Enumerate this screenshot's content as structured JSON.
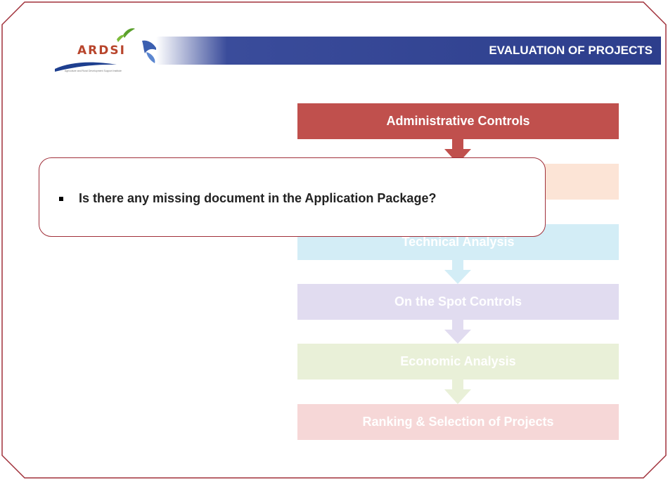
{
  "logo": {
    "name": "ARDSI",
    "tagline": "Agriculture and Rural Development Support Institute"
  },
  "header": {
    "title": "EVALUATION OF PROJECTS"
  },
  "flow": {
    "steps": [
      {
        "label": "Administrative Controls",
        "color": "#c0504d"
      },
      {
        "label": "",
        "color": "#fce4d6"
      },
      {
        "label": "Technical Analysis",
        "color": "#d3edf6"
      },
      {
        "label": "On the Spot Controls",
        "color": "#e1dcf0"
      },
      {
        "label": "Economic Analysis",
        "color": "#e9f0d8"
      },
      {
        "label": "Ranking & Selection of Projects",
        "color": "#f6d7d7"
      }
    ]
  },
  "callout": {
    "items": [
      "Is there any missing document in the Application Package?"
    ]
  },
  "colors": {
    "frame": "#a0303a",
    "title_bar": "#2d3e8c",
    "accent": "#c0504d"
  }
}
